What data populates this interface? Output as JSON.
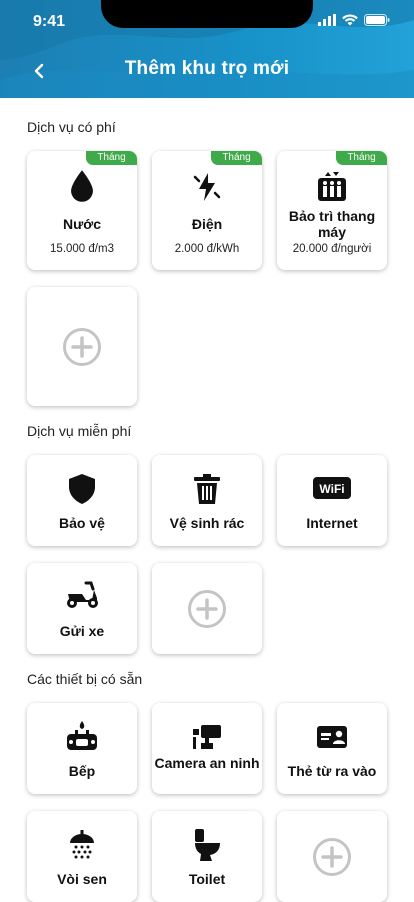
{
  "status": {
    "time": "9:41"
  },
  "header": {
    "title": "Thêm khu trọ mới"
  },
  "sections": {
    "paid": "Dịch vụ có phí",
    "free": "Dịch vụ miễn phí",
    "equipment": "Các thiết bị có sẵn"
  },
  "paid_services": [
    {
      "icon": "water-drop-icon",
      "name": "Nước",
      "price": "15.000 đ/m3",
      "badge": "Tháng"
    },
    {
      "icon": "electric-bolt-icon",
      "name": "Điện",
      "price": "2.000 đ/kWh",
      "badge": "Tháng"
    },
    {
      "icon": "elevator-icon",
      "name": "Bảo trì thang máy",
      "price": "20.000 đ/người",
      "badge": "Tháng"
    }
  ],
  "free_services": [
    {
      "icon": "shield-icon",
      "name": "Bảo vệ"
    },
    {
      "icon": "trash-icon",
      "name": "Vệ sinh rác"
    },
    {
      "icon": "wifi-icon",
      "name": "Internet"
    },
    {
      "icon": "motorbike-icon",
      "name": "Gửi xe"
    }
  ],
  "equipment": [
    {
      "icon": "stove-icon",
      "name": "Bếp"
    },
    {
      "icon": "security-camera-icon",
      "name": "Camera an ninh"
    },
    {
      "icon": "access-card-icon",
      "name": "Thẻ từ ra vào"
    },
    {
      "icon": "shower-icon",
      "name": "Vòi sen"
    },
    {
      "icon": "toilet-icon",
      "name": "Toilet"
    }
  ],
  "colors": {
    "header": "#1892c9",
    "badge": "#3eaa4a",
    "add_icon": "#c4c4c4"
  }
}
